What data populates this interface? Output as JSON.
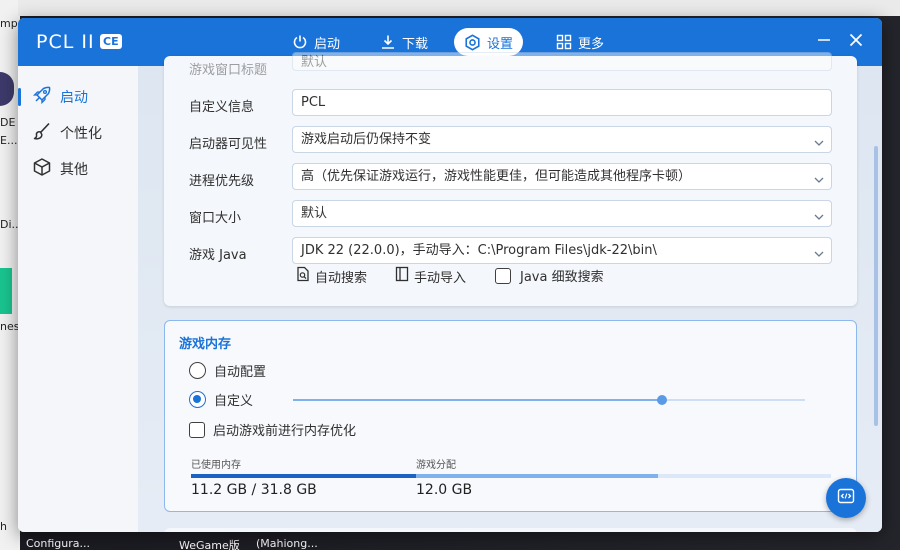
{
  "desktop": {
    "left_labels": [
      "mp",
      "DE",
      "E...",
      "Di...",
      "nes",
      "h"
    ],
    "bottom_labels": [
      "Configura...",
      "WeGame版",
      "(Mahiong..."
    ]
  },
  "window": {
    "app_name": "PCL II",
    "edition_badge": "CE",
    "accent_color": "#1a73d9",
    "nav": [
      {
        "label": "启动",
        "icon": "power-icon"
      },
      {
        "label": "下载",
        "icon": "download-icon"
      },
      {
        "label": "设置",
        "icon": "gear-icon",
        "active": true
      },
      {
        "label": "更多",
        "icon": "grid-icon"
      }
    ]
  },
  "sidebar": {
    "items": [
      {
        "label": "启动",
        "icon": "rocket-icon",
        "active": true
      },
      {
        "label": "个性化",
        "icon": "brush-icon"
      },
      {
        "label": "其他",
        "icon": "cube-icon"
      }
    ]
  },
  "launch_settings": {
    "partial_row": {
      "label": "游戏窗口标题",
      "value": "默认"
    },
    "custom_info": {
      "label": "自定义信息",
      "value": "PCL"
    },
    "launcher_visibility": {
      "label": "启动器可见性",
      "value": "游戏启动后仍保持不变"
    },
    "process_priority": {
      "label": "进程优先级",
      "value": "高（优先保证游戏运行，游戏性能更佳，但可能造成其他程序卡顿）"
    },
    "window_size": {
      "label": "窗口大小",
      "value": "默认"
    },
    "game_java": {
      "label": "游戏 Java",
      "value": "JDK 22 (22.0.0)，手动导入：C:\\Program Files\\jdk-22\\bin\\"
    },
    "auto_search": "自动搜索",
    "manual_import": "手动导入",
    "java_detailed_search": "Java 细致搜索"
  },
  "memory": {
    "title": "游戏内存",
    "auto_config": "自动配置",
    "custom": "自定义",
    "custom_selected": true,
    "optimize_before_launch": "启动游戏前进行内存优化",
    "optimize_checked": false,
    "slider_fraction": 0.72,
    "used_label": "已使用内存",
    "used_value": "11.2 GB / 31.8 GB",
    "used_fraction": 0.352,
    "alloc_label": "游戏分配",
    "alloc_value": "12.0 GB",
    "alloc_fraction": 0.377
  }
}
